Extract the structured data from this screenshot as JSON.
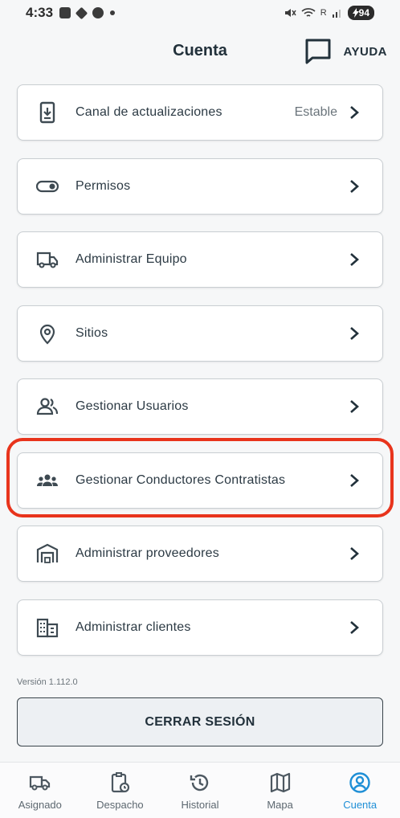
{
  "status_bar": {
    "time": "4:33",
    "battery": "94",
    "signal_text": "R"
  },
  "header": {
    "title": "Cuenta",
    "help_label": "AYUDA"
  },
  "menu": [
    {
      "label": "Canal de actualizaciones",
      "value": "Estable",
      "icon": "download-phone-icon"
    },
    {
      "label": "Permisos",
      "value": "",
      "icon": "toggle-icon"
    },
    {
      "label": "Administrar Equipo",
      "value": "",
      "icon": "truck-icon"
    },
    {
      "label": "Sitios",
      "value": "",
      "icon": "location-pin-icon"
    },
    {
      "label": "Gestionar Usuarios",
      "value": "",
      "icon": "users-icon"
    },
    {
      "label": "Gestionar Conductores Contratistas",
      "value": "",
      "icon": "group-icon"
    },
    {
      "label": "Administrar proveedores",
      "value": "",
      "icon": "warehouse-icon"
    },
    {
      "label": "Administrar clientes",
      "value": "",
      "icon": "building-icon"
    }
  ],
  "version": "Versión 1.112.0",
  "logout_label": "CERRAR SESIÓN",
  "bottom_nav": [
    {
      "label": "Asignado",
      "icon": "truck-icon"
    },
    {
      "label": "Despacho",
      "icon": "clipboard-clock-icon"
    },
    {
      "label": "Historial",
      "icon": "history-icon"
    },
    {
      "label": "Mapa",
      "icon": "map-icon"
    },
    {
      "label": "Cuenta",
      "icon": "account-icon",
      "active": true
    }
  ],
  "colors": {
    "accent": "#1f8fd6",
    "highlight": "#e8341c",
    "text": "#2c3a44"
  }
}
